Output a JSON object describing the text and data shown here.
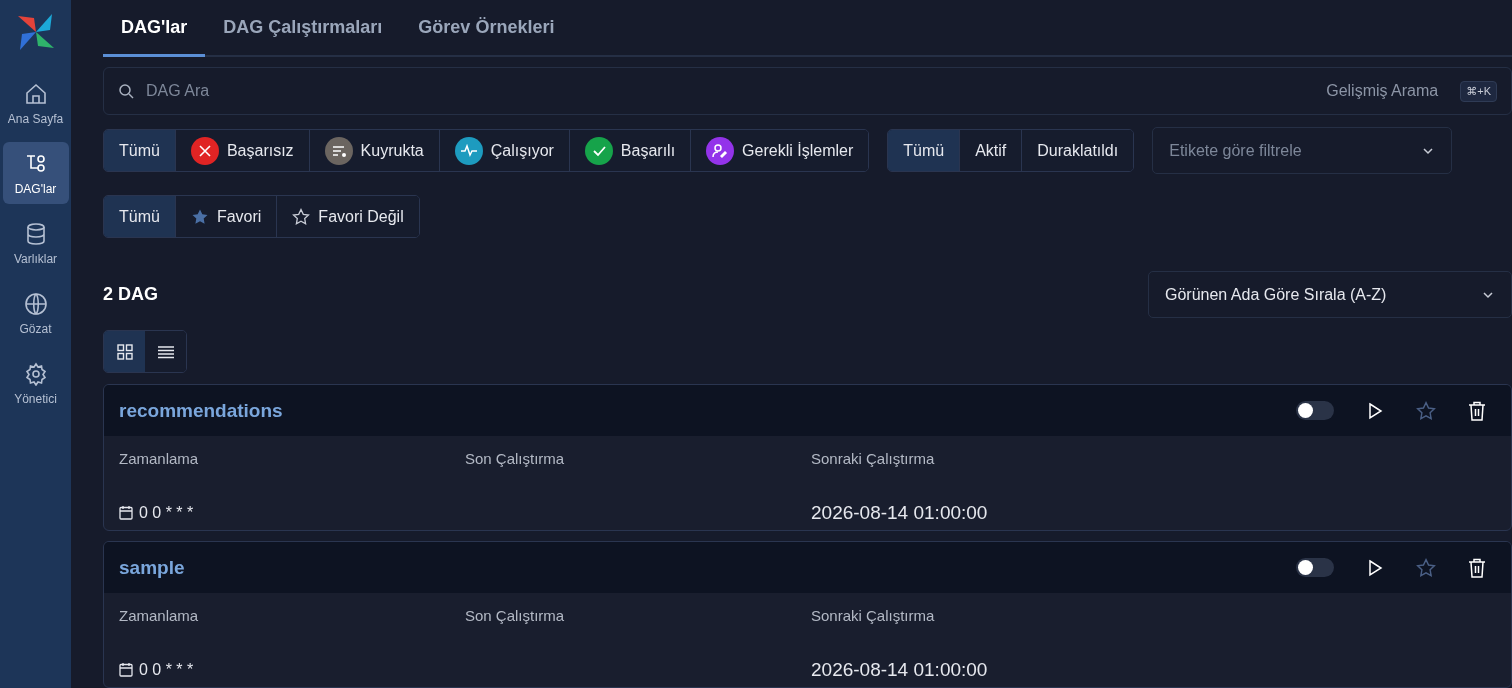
{
  "sidebar": {
    "items": [
      {
        "kind": "home",
        "label": "Ana Sayfa",
        "selected": false
      },
      {
        "kind": "dags",
        "label": "DAG'lar",
        "selected": true
      },
      {
        "kind": "assets",
        "label": "Varlıklar",
        "selected": false
      },
      {
        "kind": "browse",
        "label": "Gözat",
        "selected": false
      },
      {
        "kind": "admin",
        "label": "Yönetici",
        "selected": false
      }
    ]
  },
  "tabs": [
    {
      "label": "DAG'lar",
      "selected": true
    },
    {
      "label": "DAG Çalıştırmaları",
      "selected": false
    },
    {
      "label": "Görev Örnekleri",
      "selected": false
    }
  ],
  "search": {
    "placeholder": "DAG Ara",
    "advanced_label": "Gelişmiş Arama",
    "shortcut": "⌘+K"
  },
  "status_filters": [
    {
      "kind": "all",
      "label": "Tümü",
      "selected": true
    },
    {
      "kind": "failed",
      "label": "Başarısız",
      "selected": false
    },
    {
      "kind": "queued",
      "label": "Kuyrukta",
      "selected": false
    },
    {
      "kind": "running",
      "label": "Çalışıyor",
      "selected": false
    },
    {
      "kind": "success",
      "label": "Başarılı",
      "selected": false
    },
    {
      "kind": "required_actions",
      "label": "Gerekli İşlemler",
      "selected": false
    }
  ],
  "active_filters": [
    {
      "label": "Tümü",
      "selected": true
    },
    {
      "label": "Aktif",
      "selected": false
    },
    {
      "label": "Duraklatıldı",
      "selected": false
    }
  ],
  "tag_filter": {
    "placeholder": "Etikete göre filtrele"
  },
  "favorite_filters": [
    {
      "kind": "all",
      "label": "Tümü",
      "selected": true
    },
    {
      "kind": "favorite",
      "label": "Favori",
      "selected": false
    },
    {
      "kind": "not_favorite",
      "label": "Favori Değil",
      "selected": false
    }
  ],
  "count": "2 DAG",
  "sort": {
    "value": "Görünen Ada Göre Sırala (A-Z)"
  },
  "view_toggle": [
    {
      "kind": "grid",
      "selected": true
    },
    {
      "kind": "list",
      "selected": false
    }
  ],
  "dags": [
    {
      "name": "recommendations",
      "on": false,
      "favorite": false,
      "schedule_label": "Zamanlama",
      "last_run_label": "Son Çalıştırma",
      "next_run_label": "Sonraki Çalıştırma",
      "schedule": "0 0 * * *",
      "next_run": "2026-08-14 01:00:00"
    },
    {
      "name": "sample",
      "on": false,
      "favorite": false,
      "schedule_label": "Zamanlama",
      "last_run_label": "Son Çalıştırma",
      "next_run_label": "Sonraki Çalıştırma",
      "schedule": "0 0 * * *",
      "next_run": "2026-08-14 01:00:00"
    }
  ]
}
